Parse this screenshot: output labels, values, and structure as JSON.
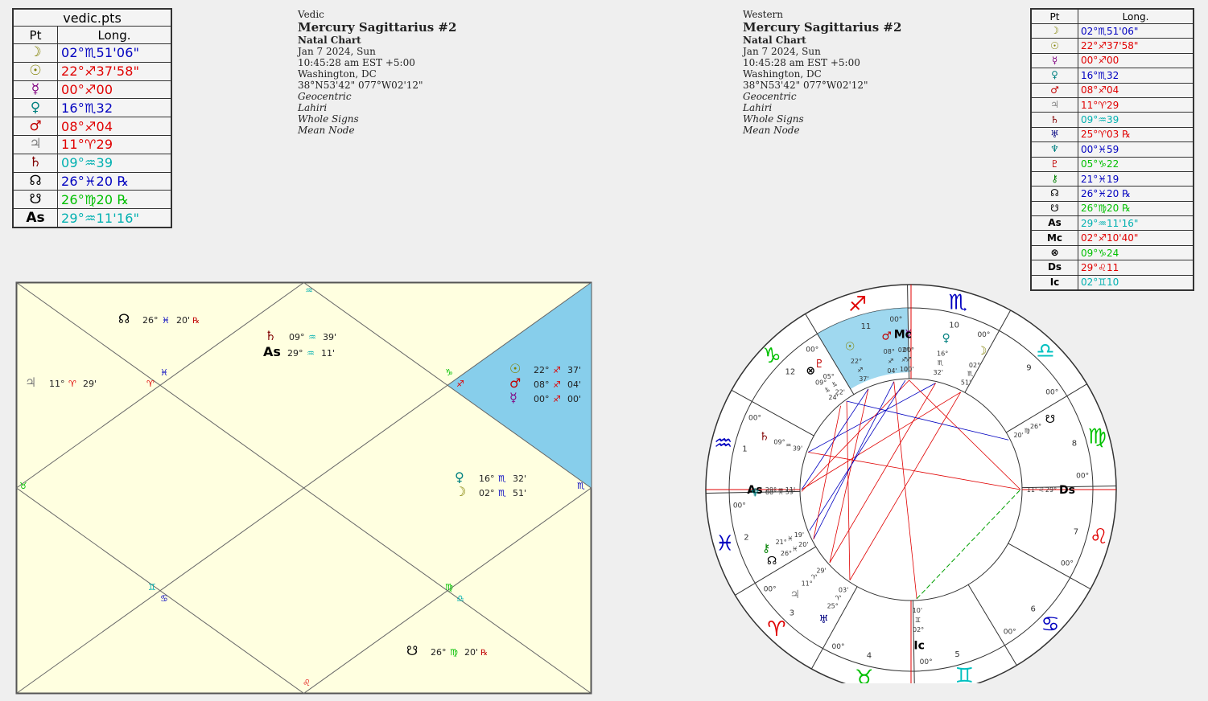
{
  "colors": {
    "moon": "#808000",
    "sun": "#808000",
    "mercury": "#800080",
    "venus": "#008080",
    "mars": "#c00000",
    "jupiter": "#808080",
    "saturn": "#800000",
    "node": "#000080",
    "south_node": "#00c000",
    "asc": "#00c0c0",
    "red": "#e00000",
    "blue": "#0000c0",
    "cyan": "#00b0b0",
    "green": "#00c000",
    "chart_bg": "#ffffe0",
    "highlight": "#87ceeb"
  },
  "vedic_table": {
    "title": "vedic.pts",
    "headers": [
      "Pt",
      "Long."
    ],
    "rows": [
      {
        "glyph": "☽",
        "icon": "moon-icon",
        "value": "02°♏51'06\"",
        "color": "#0000c0",
        "gcolor": "#808000"
      },
      {
        "glyph": "☉",
        "icon": "sun-icon",
        "value": "22°♐37'58\"",
        "color": "#e00000",
        "gcolor": "#808000"
      },
      {
        "glyph": "☿",
        "icon": "mercury-icon",
        "value": "00°♐00",
        "color": "#e00000",
        "gcolor": "#800080"
      },
      {
        "glyph": "♀",
        "icon": "venus-icon",
        "value": "16°♏32",
        "color": "#0000c0",
        "gcolor": "#008080"
      },
      {
        "glyph": "♂",
        "icon": "mars-icon",
        "value": "08°♐04",
        "color": "#e00000",
        "gcolor": "#c00000"
      },
      {
        "glyph": "♃",
        "icon": "jupiter-icon",
        "value": "11°♈29",
        "color": "#e00000",
        "gcolor": "#808080"
      },
      {
        "glyph": "♄",
        "icon": "saturn-icon",
        "value": "09°♒39",
        "color": "#00b0b0",
        "gcolor": "#800000"
      },
      {
        "glyph": "☊",
        "icon": "north-node-icon",
        "value": "26°♓20 ℞",
        "color": "#0000c0",
        "gcolor": "#000000"
      },
      {
        "glyph": "☋",
        "icon": "south-node-icon",
        "value": "26°♍20 ℞",
        "color": "#00c000",
        "gcolor": "#000000"
      },
      {
        "glyph": "As",
        "icon": "ascendant-icon",
        "value": "29°♒11'16\"",
        "color": "#00b0b0",
        "gcolor": "#000000"
      }
    ]
  },
  "vedic_header": {
    "system": "Vedic",
    "name": "Mercury Sagittarius #2",
    "chart_type": "Natal Chart",
    "date": "Jan 7 2024, Sun",
    "time": "10:45:28 am  EST +5:00",
    "place": "Washington, DC",
    "coords": "38°N53'42\" 077°W02'12\"",
    "centric": "Geocentric",
    "ayanamsa": "Lahiri",
    "houses": "Whole Signs",
    "node": "Mean Node"
  },
  "western_header": {
    "system": "Western",
    "name": "Mercury Sagittarius #2",
    "chart_type": "Natal Chart",
    "date": "Jan 7 2024, Sun",
    "time": "10:45:28 am  EST +5:00",
    "place": "Washington, DC",
    "coords": "38°N53'42\" 077°W02'12\"",
    "centric": "Geocentric",
    "ayanamsa": "Lahiri",
    "houses": "Whole Signs",
    "node": "Mean Node"
  },
  "west_table": {
    "headers": [
      "Pt",
      "Long."
    ],
    "rows": [
      {
        "glyph": "☽",
        "icon": "moon-icon",
        "value": "02°♏51'06\"",
        "color": "#0000c0",
        "gcolor": "#808000"
      },
      {
        "glyph": "☉",
        "icon": "sun-icon",
        "value": "22°♐37'58\"",
        "color": "#e00000",
        "gcolor": "#808000"
      },
      {
        "glyph": "☿",
        "icon": "mercury-icon",
        "value": "00°♐00",
        "color": "#e00000",
        "gcolor": "#800080"
      },
      {
        "glyph": "♀",
        "icon": "venus-icon",
        "value": "16°♏32",
        "color": "#0000c0",
        "gcolor": "#008080"
      },
      {
        "glyph": "♂",
        "icon": "mars-icon",
        "value": "08°♐04",
        "color": "#e00000",
        "gcolor": "#c00000"
      },
      {
        "glyph": "♃",
        "icon": "jupiter-icon",
        "value": "11°♈29",
        "color": "#e00000",
        "gcolor": "#808080"
      },
      {
        "glyph": "♄",
        "icon": "saturn-icon",
        "value": "09°♒39",
        "color": "#00b0b0",
        "gcolor": "#800000"
      },
      {
        "glyph": "♅",
        "icon": "uranus-icon",
        "value": "25°♈03 ℞",
        "color": "#e00000",
        "gcolor": "#000080"
      },
      {
        "glyph": "♆",
        "icon": "neptune-icon",
        "value": "00°♓59",
        "color": "#0000c0",
        "gcolor": "#008080"
      },
      {
        "glyph": "♇",
        "icon": "pluto-icon",
        "value": "05°♑22",
        "color": "#00c000",
        "gcolor": "#c00000"
      },
      {
        "glyph": "⚷",
        "icon": "chiron-icon",
        "value": "21°♓19",
        "color": "#0000c0",
        "gcolor": "#008000"
      },
      {
        "glyph": "☊",
        "icon": "north-node-icon",
        "value": "26°♓20 ℞",
        "color": "#0000c0",
        "gcolor": "#000000"
      },
      {
        "glyph": "☋",
        "icon": "south-node-icon",
        "value": "26°♍20 ℞",
        "color": "#00c000",
        "gcolor": "#000000"
      },
      {
        "glyph": "As",
        "icon": "ascendant-icon",
        "value": "29°♒11'16\"",
        "color": "#00b0b0",
        "gcolor": "#000000"
      },
      {
        "glyph": "Mc",
        "icon": "midheaven-icon",
        "value": "02°♐10'40\"",
        "color": "#e00000",
        "gcolor": "#000000"
      },
      {
        "glyph": "⊗",
        "icon": "part-of-fortune-icon",
        "value": "09°♑24",
        "color": "#00c000",
        "gcolor": "#000000"
      },
      {
        "glyph": "Ds",
        "icon": "descendant-icon",
        "value": "29°♌11",
        "color": "#e00000",
        "gcolor": "#000000"
      },
      {
        "glyph": "Ic",
        "icon": "imum-coeli-icon",
        "value": "02°♊10",
        "color": "#00b0b0",
        "gcolor": "#000000"
      }
    ]
  },
  "vedic_chart": {
    "sign_markers": [
      {
        "glyph": "♒",
        "color": "#00b0b0"
      },
      {
        "glyph": "♓",
        "color": "#0000c0"
      },
      {
        "glyph": "♈",
        "color": "#e00000"
      },
      {
        "glyph": "♑",
        "color": "#00c000"
      },
      {
        "glyph": "♐",
        "color": "#e00000"
      },
      {
        "glyph": "♉",
        "color": "#00c000"
      },
      {
        "glyph": "♏",
        "color": "#0000c0"
      },
      {
        "glyph": "♊",
        "color": "#00b0b0"
      },
      {
        "glyph": "♋",
        "color": "#0000c0"
      },
      {
        "glyph": "♍",
        "color": "#00c000"
      },
      {
        "glyph": "♎",
        "color": "#00b0b0"
      },
      {
        "glyph": "♌",
        "color": "#e00000"
      }
    ],
    "placements": [
      {
        "glyph": "☊",
        "gcolor": "#000000",
        "deg": "26°",
        "sign": "♓",
        "scolor": "#0000c0",
        "min": "20'",
        "retro": "℞"
      },
      {
        "glyph": "♄",
        "gcolor": "#800000",
        "deg": "09°",
        "sign": "♒",
        "scolor": "#00b0b0",
        "min": "39'",
        "retro": ""
      },
      {
        "glyph": "As",
        "gcolor": "#000000",
        "deg": "29°",
        "sign": "♒",
        "scolor": "#00b0b0",
        "min": "11'",
        "retro": ""
      },
      {
        "glyph": "♃",
        "gcolor": "#808080",
        "deg": "11°",
        "sign": "♈",
        "scolor": "#e00000",
        "min": "29'",
        "retro": ""
      },
      {
        "glyph": "☉",
        "gcolor": "#808000",
        "deg": "22°",
        "sign": "♐",
        "scolor": "#e00000",
        "min": "37'",
        "retro": ""
      },
      {
        "glyph": "♂",
        "gcolor": "#c00000",
        "deg": "08°",
        "sign": "♐",
        "scolor": "#e00000",
        "min": "04'",
        "retro": ""
      },
      {
        "glyph": "☿",
        "gcolor": "#800080",
        "deg": "00°",
        "sign": "♐",
        "scolor": "#e00000",
        "min": "00'",
        "retro": ""
      },
      {
        "glyph": "♀",
        "gcolor": "#008080",
        "deg": "16°",
        "sign": "♏",
        "scolor": "#0000c0",
        "min": "32'",
        "retro": ""
      },
      {
        "glyph": "☽",
        "gcolor": "#808000",
        "deg": "02°",
        "sign": "♏",
        "scolor": "#0000c0",
        "min": "51'",
        "retro": ""
      },
      {
        "glyph": "☋",
        "gcolor": "#000000",
        "deg": "26°",
        "sign": "♍",
        "scolor": "#00c000",
        "min": "20'",
        "retro": "℞"
      }
    ]
  },
  "wheel": {
    "house_numbers": [
      "1",
      "2",
      "3",
      "4",
      "5",
      "6",
      "7",
      "8",
      "9",
      "10",
      "11",
      "12"
    ],
    "cusp_degree": "00°",
    "signs": [
      {
        "glyph": "♒",
        "color": "#0000c0"
      },
      {
        "glyph": "♓",
        "color": "#0000c0"
      },
      {
        "glyph": "♈",
        "color": "#e00000"
      },
      {
        "glyph": "♉",
        "color": "#00c000"
      },
      {
        "glyph": "♊",
        "color": "#00c0c0"
      },
      {
        "glyph": "♋",
        "color": "#0000c0"
      },
      {
        "glyph": "♌",
        "color": "#e00000"
      },
      {
        "glyph": "♍",
        "color": "#00c000"
      },
      {
        "glyph": "♎",
        "color": "#00c0c0"
      },
      {
        "glyph": "♏",
        "color": "#0000c0"
      },
      {
        "glyph": "♐",
        "color": "#e00000"
      },
      {
        "glyph": "♑",
        "color": "#00c000"
      }
    ],
    "planets": [
      {
        "glyph": "♀",
        "color": "#008080",
        "deg": "16°",
        "sign": "♏",
        "min": "32'"
      },
      {
        "glyph": "☽",
        "color": "#808000",
        "deg": "02°",
        "sign": "♏",
        "min": "51'"
      },
      {
        "glyph": "☿",
        "color": "#800080",
        "deg": "00°",
        "sign": "♐",
        "min": "00'"
      },
      {
        "glyph": "Mc",
        "color": "#000000",
        "deg": "02°",
        "sign": "♐",
        "min": "10'"
      },
      {
        "glyph": "♂",
        "color": "#c00000",
        "deg": "08°",
        "sign": "♐",
        "min": "04'"
      },
      {
        "glyph": "☉",
        "color": "#808000",
        "deg": "22°",
        "sign": "♐",
        "min": "37'"
      },
      {
        "glyph": "♇",
        "color": "#c00000",
        "deg": "05°",
        "sign": "♑",
        "min": "22'"
      },
      {
        "glyph": "⊗",
        "color": "#000000",
        "deg": "09°",
        "sign": "♑",
        "min": "24'"
      },
      {
        "glyph": "♄",
        "color": "#800000",
        "deg": "09°",
        "sign": "♒",
        "min": "39'"
      },
      {
        "glyph": "As",
        "color": "#000000",
        "deg": "29°",
        "sign": "♒",
        "min": "11'"
      },
      {
        "glyph": "♆",
        "color": "#008080",
        "deg": "00°",
        "sign": "♓",
        "min": "59'"
      },
      {
        "glyph": "⚷",
        "color": "#008000",
        "deg": "21°",
        "sign": "♓",
        "min": "19'"
      },
      {
        "glyph": "☊",
        "color": "#000000",
        "deg": "26°",
        "sign": "♓",
        "min": "20'"
      },
      {
        "glyph": "♃",
        "color": "#808080",
        "deg": "11°",
        "sign": "♈",
        "min": "29'"
      },
      {
        "glyph": "♅",
        "color": "#000080",
        "deg": "25°",
        "sign": "♈",
        "min": "03'"
      },
      {
        "glyph": "Ic",
        "color": "#000000",
        "deg": "02°",
        "sign": "♊",
        "min": "10'"
      },
      {
        "glyph": "Ds",
        "color": "#000000",
        "deg": "29°",
        "sign": "♌",
        "min": "11'"
      },
      {
        "glyph": "☋",
        "color": "#000000",
        "deg": "26°",
        "sign": "♍",
        "min": "20'"
      }
    ]
  }
}
